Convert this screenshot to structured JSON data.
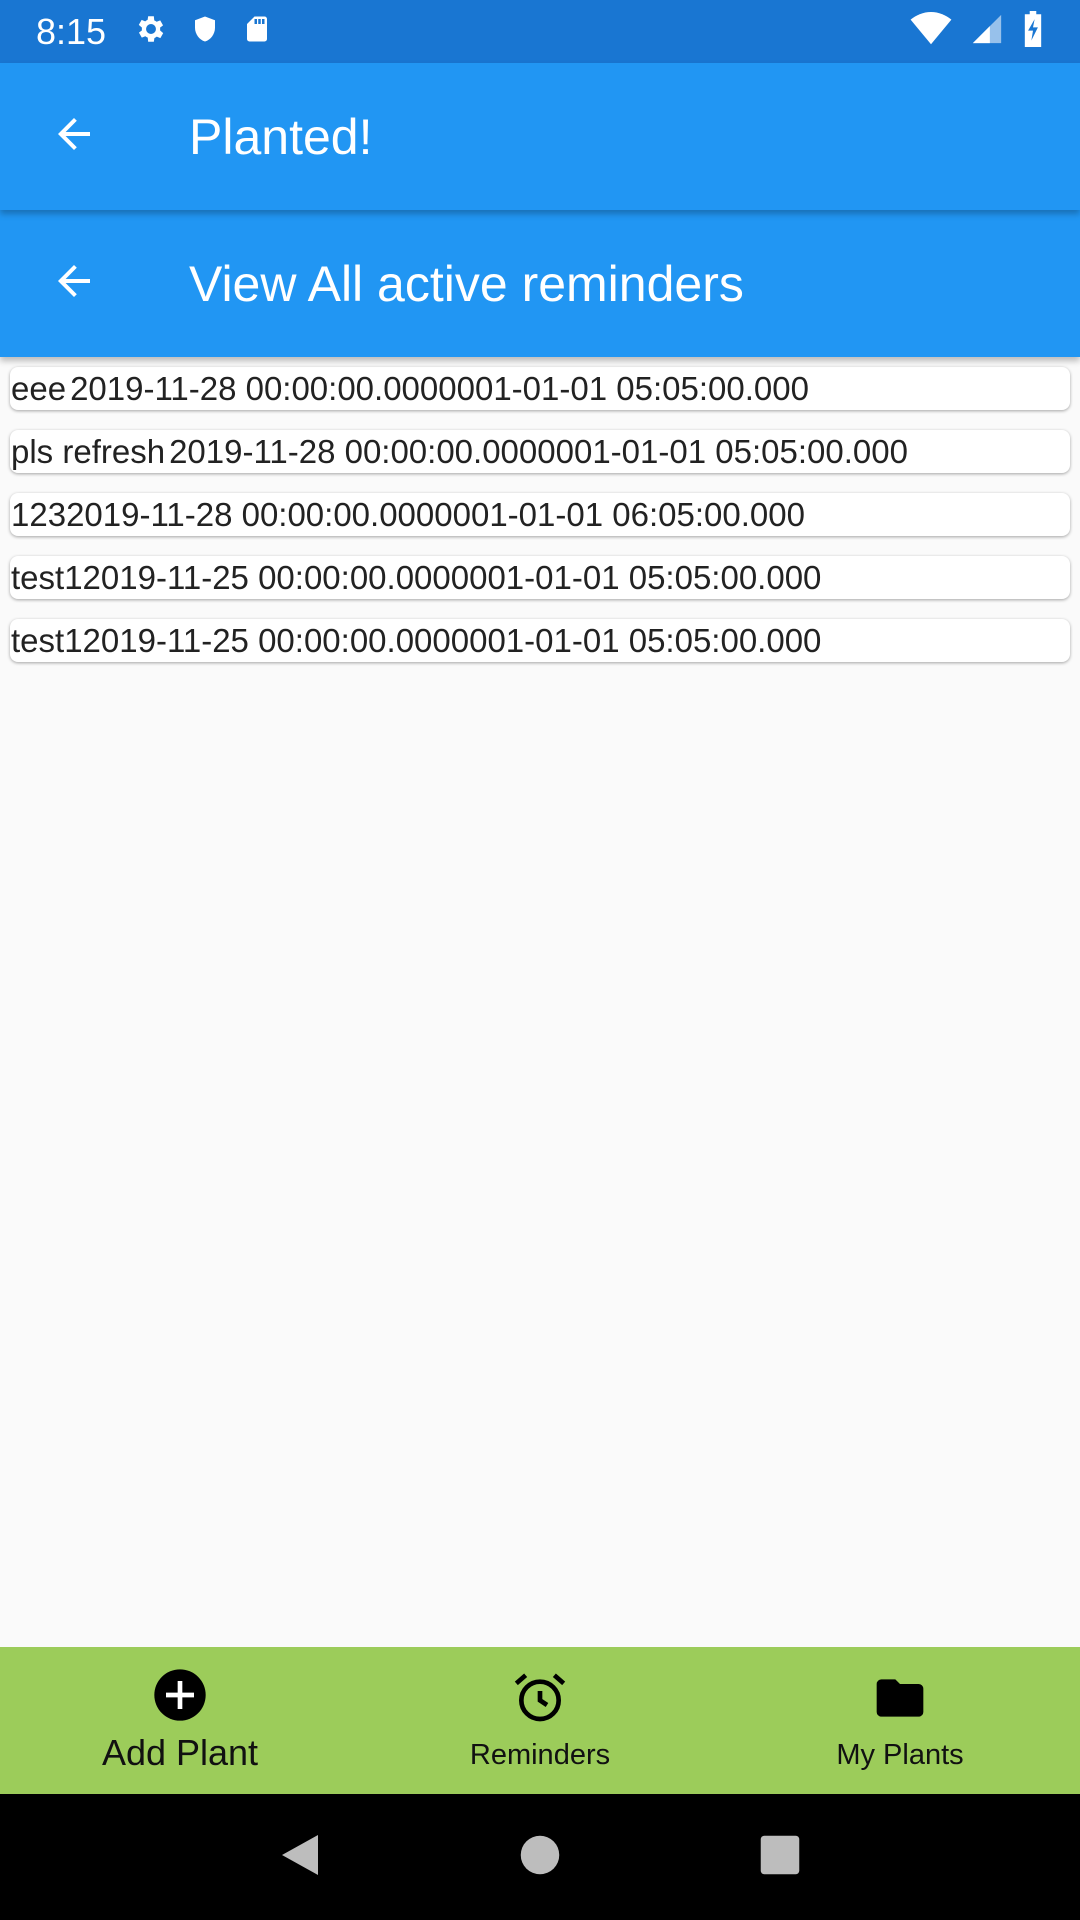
{
  "status_bar": {
    "time": "8:15",
    "icons_left": [
      "gear-icon",
      "shield-icon",
      "sd-card-icon"
    ],
    "icons_right": [
      "wifi-icon",
      "signal-icon",
      "battery-icon"
    ]
  },
  "appbar_primary": {
    "title": "Planted!"
  },
  "appbar_secondary": {
    "title": "View All active reminders"
  },
  "reminders": [
    {
      "name": "eee",
      "details": "2019-11-28 00:00:00.0000001-01-01 05:05:00.000"
    },
    {
      "name": "pls refresh",
      "details": "2019-11-28 00:00:00.0000001-01-01 05:05:00.000"
    },
    {
      "name": "123",
      "details": "2019-11-28 00:00:00.0000001-01-01 06:05:00.000"
    },
    {
      "name": "test1",
      "details": "2019-11-25 00:00:00.0000001-01-01 05:05:00.000"
    },
    {
      "name": "test1",
      "details": "2019-11-25 00:00:00.0000001-01-01 05:05:00.000"
    }
  ],
  "bottom_nav": {
    "items": [
      {
        "label": "Add Plant",
        "icon": "add-circle-icon",
        "active": true
      },
      {
        "label": "Reminders",
        "icon": "alarm-clock-icon",
        "active": false
      },
      {
        "label": "My Plants",
        "icon": "folder-icon",
        "active": false
      }
    ]
  },
  "colors": {
    "status_bar": "#1976d2",
    "appbar": "#2196f3",
    "bottom_nav": "#9ccc5a",
    "background": "#fafafa"
  }
}
